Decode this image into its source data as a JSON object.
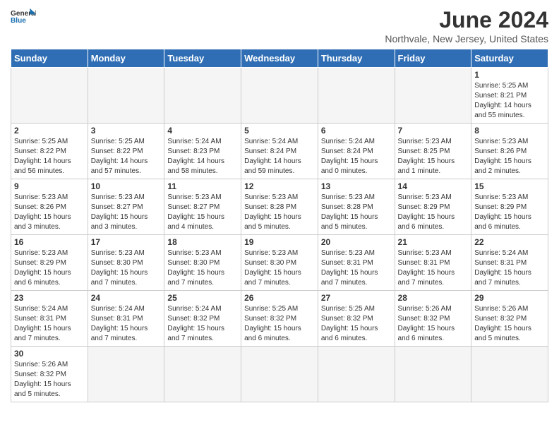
{
  "logo": {
    "text_general": "General",
    "text_blue": "Blue"
  },
  "title": "June 2024",
  "location": "Northvale, New Jersey, United States",
  "days_of_week": [
    "Sunday",
    "Monday",
    "Tuesday",
    "Wednesday",
    "Thursday",
    "Friday",
    "Saturday"
  ],
  "weeks": [
    [
      {
        "day": "",
        "info": ""
      },
      {
        "day": "",
        "info": ""
      },
      {
        "day": "",
        "info": ""
      },
      {
        "day": "",
        "info": ""
      },
      {
        "day": "",
        "info": ""
      },
      {
        "day": "",
        "info": ""
      },
      {
        "day": "1",
        "info": "Sunrise: 5:25 AM\nSunset: 8:21 PM\nDaylight: 14 hours\nand 55 minutes."
      }
    ],
    [
      {
        "day": "2",
        "info": "Sunrise: 5:25 AM\nSunset: 8:22 PM\nDaylight: 14 hours\nand 56 minutes."
      },
      {
        "day": "3",
        "info": "Sunrise: 5:25 AM\nSunset: 8:22 PM\nDaylight: 14 hours\nand 57 minutes."
      },
      {
        "day": "4",
        "info": "Sunrise: 5:24 AM\nSunset: 8:23 PM\nDaylight: 14 hours\nand 58 minutes."
      },
      {
        "day": "5",
        "info": "Sunrise: 5:24 AM\nSunset: 8:24 PM\nDaylight: 14 hours\nand 59 minutes."
      },
      {
        "day": "6",
        "info": "Sunrise: 5:24 AM\nSunset: 8:24 PM\nDaylight: 15 hours\nand 0 minutes."
      },
      {
        "day": "7",
        "info": "Sunrise: 5:23 AM\nSunset: 8:25 PM\nDaylight: 15 hours\nand 1 minute."
      },
      {
        "day": "8",
        "info": "Sunrise: 5:23 AM\nSunset: 8:26 PM\nDaylight: 15 hours\nand 2 minutes."
      }
    ],
    [
      {
        "day": "9",
        "info": "Sunrise: 5:23 AM\nSunset: 8:26 PM\nDaylight: 15 hours\nand 3 minutes."
      },
      {
        "day": "10",
        "info": "Sunrise: 5:23 AM\nSunset: 8:27 PM\nDaylight: 15 hours\nand 3 minutes."
      },
      {
        "day": "11",
        "info": "Sunrise: 5:23 AM\nSunset: 8:27 PM\nDaylight: 15 hours\nand 4 minutes."
      },
      {
        "day": "12",
        "info": "Sunrise: 5:23 AM\nSunset: 8:28 PM\nDaylight: 15 hours\nand 5 minutes."
      },
      {
        "day": "13",
        "info": "Sunrise: 5:23 AM\nSunset: 8:28 PM\nDaylight: 15 hours\nand 5 minutes."
      },
      {
        "day": "14",
        "info": "Sunrise: 5:23 AM\nSunset: 8:29 PM\nDaylight: 15 hours\nand 6 minutes."
      },
      {
        "day": "15",
        "info": "Sunrise: 5:23 AM\nSunset: 8:29 PM\nDaylight: 15 hours\nand 6 minutes."
      }
    ],
    [
      {
        "day": "16",
        "info": "Sunrise: 5:23 AM\nSunset: 8:29 PM\nDaylight: 15 hours\nand 6 minutes."
      },
      {
        "day": "17",
        "info": "Sunrise: 5:23 AM\nSunset: 8:30 PM\nDaylight: 15 hours\nand 7 minutes."
      },
      {
        "day": "18",
        "info": "Sunrise: 5:23 AM\nSunset: 8:30 PM\nDaylight: 15 hours\nand 7 minutes."
      },
      {
        "day": "19",
        "info": "Sunrise: 5:23 AM\nSunset: 8:30 PM\nDaylight: 15 hours\nand 7 minutes."
      },
      {
        "day": "20",
        "info": "Sunrise: 5:23 AM\nSunset: 8:31 PM\nDaylight: 15 hours\nand 7 minutes."
      },
      {
        "day": "21",
        "info": "Sunrise: 5:23 AM\nSunset: 8:31 PM\nDaylight: 15 hours\nand 7 minutes."
      },
      {
        "day": "22",
        "info": "Sunrise: 5:24 AM\nSunset: 8:31 PM\nDaylight: 15 hours\nand 7 minutes."
      }
    ],
    [
      {
        "day": "23",
        "info": "Sunrise: 5:24 AM\nSunset: 8:31 PM\nDaylight: 15 hours\nand 7 minutes."
      },
      {
        "day": "24",
        "info": "Sunrise: 5:24 AM\nSunset: 8:31 PM\nDaylight: 15 hours\nand 7 minutes."
      },
      {
        "day": "25",
        "info": "Sunrise: 5:24 AM\nSunset: 8:32 PM\nDaylight: 15 hours\nand 7 minutes."
      },
      {
        "day": "26",
        "info": "Sunrise: 5:25 AM\nSunset: 8:32 PM\nDaylight: 15 hours\nand 6 minutes."
      },
      {
        "day": "27",
        "info": "Sunrise: 5:25 AM\nSunset: 8:32 PM\nDaylight: 15 hours\nand 6 minutes."
      },
      {
        "day": "28",
        "info": "Sunrise: 5:26 AM\nSunset: 8:32 PM\nDaylight: 15 hours\nand 6 minutes."
      },
      {
        "day": "29",
        "info": "Sunrise: 5:26 AM\nSunset: 8:32 PM\nDaylight: 15 hours\nand 5 minutes."
      }
    ],
    [
      {
        "day": "30",
        "info": "Sunrise: 5:26 AM\nSunset: 8:32 PM\nDaylight: 15 hours\nand 5 minutes."
      },
      {
        "day": "",
        "info": ""
      },
      {
        "day": "",
        "info": ""
      },
      {
        "day": "",
        "info": ""
      },
      {
        "day": "",
        "info": ""
      },
      {
        "day": "",
        "info": ""
      },
      {
        "day": "",
        "info": ""
      }
    ]
  ]
}
